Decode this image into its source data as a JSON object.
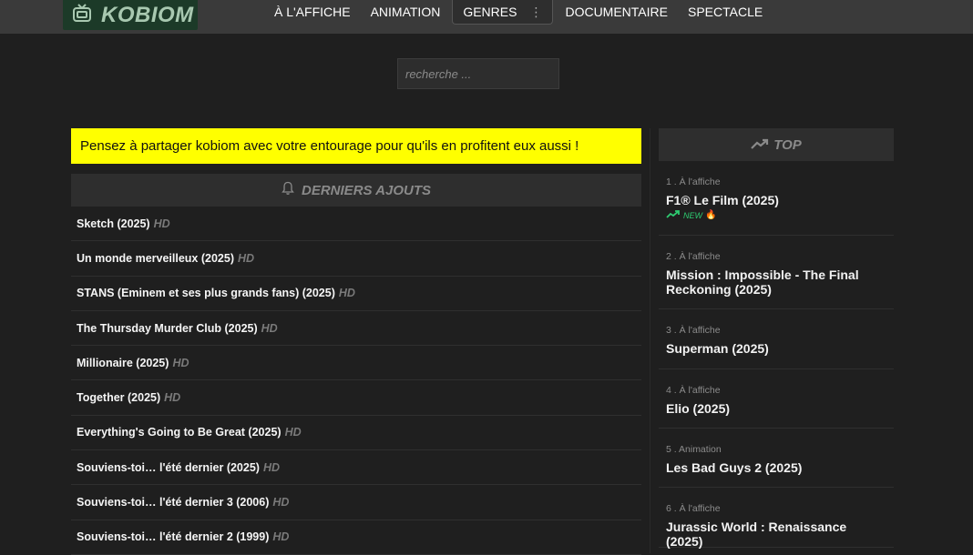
{
  "brand": {
    "name": "KOBIOM"
  },
  "nav": {
    "items": [
      "À L'AFFICHE",
      "ANIMATION",
      "GENRES",
      "DOCUMENTAIRE",
      "SPECTACLE"
    ]
  },
  "search": {
    "placeholder": "recherche ..."
  },
  "banner": {
    "text": "Pensez à partager kobiom avec votre entourage pour qu'ils en profitent eux aussi !"
  },
  "latest": {
    "heading": "DERNIERS AJOUTS",
    "items": [
      {
        "title": "Sketch (2025)",
        "quality": "HD"
      },
      {
        "title": "Un monde merveilleux (2025)",
        "quality": "HD"
      },
      {
        "title": "STANS (Eminem et ses plus grands fans) (2025)",
        "quality": "HD"
      },
      {
        "title": "The Thursday Murder Club (2025)",
        "quality": "HD"
      },
      {
        "title": "Millionaire (2025)",
        "quality": "HD"
      },
      {
        "title": "Together (2025)",
        "quality": "HD"
      },
      {
        "title": "Everything's Going to Be Great (2025)",
        "quality": "HD"
      },
      {
        "title": "Souviens-toi… l'été dernier (2025)",
        "quality": "HD"
      },
      {
        "title": "Souviens-toi… l'été dernier 3 (2006)",
        "quality": "HD"
      },
      {
        "title": "Souviens-toi… l'été dernier 2 (1999)",
        "quality": "HD"
      }
    ]
  },
  "top": {
    "heading": "TOP",
    "items": [
      {
        "meta": "1 . À l'affiche",
        "title": "F1® Le Film (2025)",
        "badge": "NEW"
      },
      {
        "meta": "2 . À l'affiche",
        "title": "Mission : Impossible - The Final Reckoning (2025)"
      },
      {
        "meta": "3 . À l'affiche",
        "title": "Superman (2025)"
      },
      {
        "meta": "4 . À l'affiche",
        "title": "Elio (2025)"
      },
      {
        "meta": "5 . Animation",
        "title": "Les Bad Guys 2 (2025)"
      },
      {
        "meta": "6 . À l'affiche",
        "title": "Jurassic World : Renaissance (2025)"
      }
    ]
  },
  "colors": {
    "banner": "#ffff00",
    "logo_bg": "#1c3a28",
    "trend_green": "#2ecc71"
  }
}
